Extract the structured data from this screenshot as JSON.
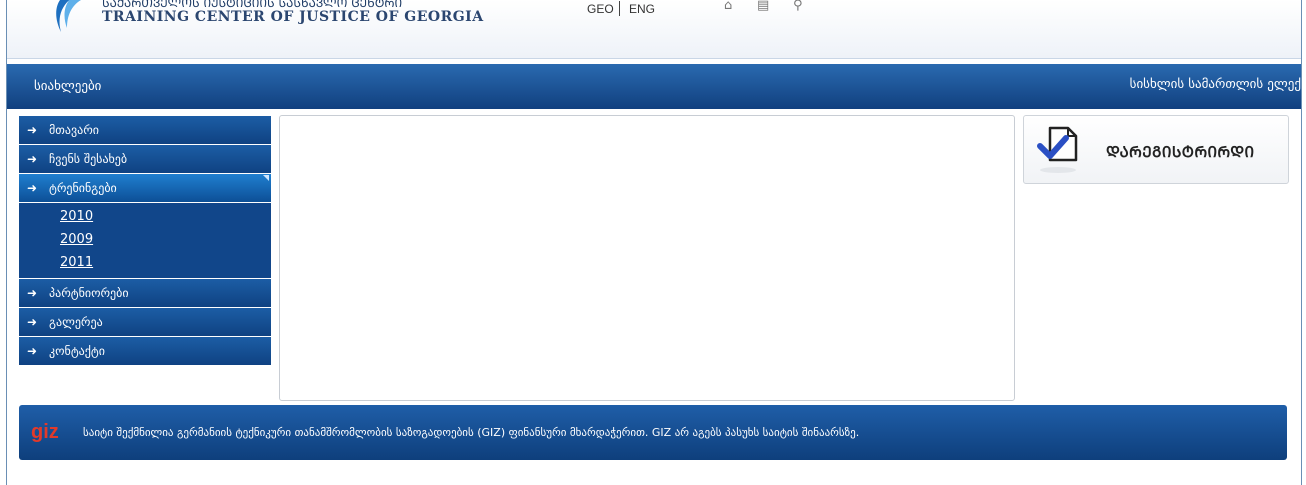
{
  "header": {
    "org_name_ge": "ᲡᲐᲥᲐᲠᲗᲕᲔᲚᲝᲡ ᲘᲣᲡᲢᲘᲪᲘᲘᲡ ᲡᲐᲡᲬᲐᲕᲚᲝ ᲪᲔᲜᲢᲠᲘ",
    "org_name_en": "TRAINING CENTER OF JUSTICE OF GEORGIA",
    "lang_geo": "GEO",
    "lang_eng": "ENG",
    "icons": [
      "home-icon",
      "document-icon",
      "sitemap-icon"
    ]
  },
  "navbar": {
    "left_label": "სიახლეები",
    "right_label": "სისხლის სამართლის ელექ"
  },
  "sidebar": {
    "items": [
      {
        "label": "მთავარი"
      },
      {
        "label": "ჩვენს შესახებ"
      },
      {
        "label": "ტრენინგები"
      },
      {
        "label": "პარტნიორები"
      },
      {
        "label": "გალერეა"
      },
      {
        "label": "კონტაქტი"
      }
    ],
    "arrow": "➜",
    "sub_items": [
      "2010",
      "2009",
      "2011"
    ]
  },
  "register": {
    "label": "ᲓᲐᲠᲔᲒᲘᲡᲢᲠᲘᲠᲓᲘ"
  },
  "footer": {
    "logo_text": "giz",
    "text": "საიტი შექმნილია გერმანიის ტექნიკური თანამშრომლობის საზოგადოების (GIZ) ფინანსური მხარდაჭერით. GIZ არ აგებს პასუხს საიტის შინაარსზე."
  },
  "colors": {
    "nav_blue": "#11407f",
    "accent_blue": "#1f7fd0",
    "giz_red": "#e23a2a",
    "check_blue": "#2a4fc4"
  }
}
